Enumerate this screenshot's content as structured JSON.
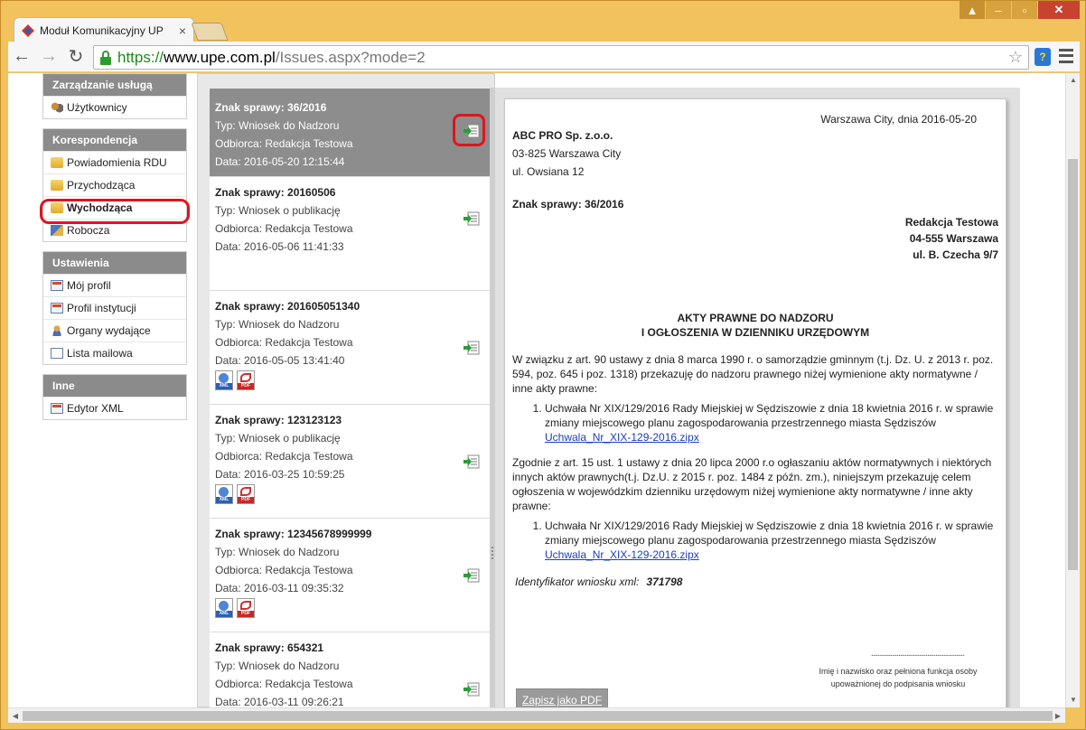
{
  "browser": {
    "tab_title": "Moduł Komunikacyjny UP",
    "tab_close": "×",
    "url_scheme": "https://",
    "url_host": "www.upe.com.pl",
    "url_path": "/Issues.aspx?mode=2",
    "ext_label": "?"
  },
  "sidebar": {
    "groups": [
      {
        "header": "Zarządzanie usługą",
        "items": [
          {
            "label": "Użytkownicy",
            "icon": "users-icon"
          }
        ]
      },
      {
        "header": "Korespondencja",
        "items": [
          {
            "label": "Powiadomienia RDU",
            "icon": "folder-icon"
          },
          {
            "label": "Przychodząca",
            "icon": "folder-icon"
          },
          {
            "label": "Wychodząca",
            "icon": "folder-icon",
            "active": true
          },
          {
            "label": "Robocza",
            "icon": "draft-icon"
          }
        ]
      },
      {
        "header": "Ustawienia",
        "items": [
          {
            "label": "Mój profil",
            "icon": "id-card-icon"
          },
          {
            "label": "Profil instytucji",
            "icon": "id-card-icon"
          },
          {
            "label": "Organy wydające",
            "icon": "person-icon"
          },
          {
            "label": "Lista mailowa",
            "icon": "mail-icon"
          }
        ]
      },
      {
        "header": "Inne",
        "items": [
          {
            "label": "Edytor XML",
            "icon": "id-card-icon"
          }
        ]
      }
    ]
  },
  "issues": [
    {
      "title": "Znak sprawy: 36/2016",
      "type": "Typ: Wniosek do Nadzoru",
      "recipient": "Odbiorca: Redakcja Testowa",
      "date": "Data: 2016-05-20 12:15:44",
      "files": false,
      "selected": true
    },
    {
      "title": "Znak sprawy: 20160506",
      "type": "Typ: Wniosek o publikację",
      "recipient": "Odbiorca: Redakcja Testowa",
      "date": "Data: 2016-05-06 11:41:33",
      "files": false
    },
    {
      "title": "Znak sprawy: 201605051340",
      "type": "Typ: Wniosek do Nadzoru",
      "recipient": "Odbiorca: Redakcja Testowa",
      "date": "Data: 2016-05-05 13:41:40",
      "files": true
    },
    {
      "title": "Znak sprawy: 123123123",
      "type": "Typ: Wniosek o publikację",
      "recipient": "Odbiorca: Redakcja Testowa",
      "date": "Data: 2016-03-25 10:59:25",
      "files": true
    },
    {
      "title": "Znak sprawy: 12345678999999",
      "type": "Typ: Wniosek do Nadzoru",
      "recipient": "Odbiorca: Redakcja Testowa",
      "date": "Data: 2016-03-11 09:35:32",
      "files": true
    },
    {
      "title": "Znak sprawy: 654321",
      "type": "Typ: Wniosek do Nadzoru",
      "recipient": "Odbiorca: Redakcja Testowa",
      "date": "Data: 2016-03-11 09:26:21",
      "files": true
    }
  ],
  "file_labels": {
    "xml": "XML",
    "pdf": "PDF"
  },
  "document": {
    "place_date": "Warszawa City, dnia 2016-05-20",
    "sender_name": "ABC PRO Sp. z.o.o.",
    "sender_city": "03-825 Warszawa City",
    "sender_street": "ul. Owsiana 12",
    "case_number": "Znak sprawy: 36/2016",
    "recipient_name": "Redakcja Testowa",
    "recipient_city": "04-555 Warszawa",
    "recipient_street": "ul. B. Czecha 9/7",
    "heading_line1": "AKTY PRAWNE DO NADZORU",
    "heading_line2": "I OGŁOSZENIA W DZIENNIKU URZĘDOWYM",
    "para1": "W związku z art. 90 ustawy z dnia 8 marca 1990 r. o samorządzie gminnym (t.j. Dz. U. z 2013 r. poz. 594, poz. 645 i poz. 1318) przekazuję do nadzoru prawnego niżej wymienione akty normatywne / inne akty prawne:",
    "item1_text": "Uchwała Nr XIX/129/2016 Rady Miejskiej w Sędziszowie z dnia 18 kwietnia 2016 r. w sprawie zmiany miejscowego planu zagospodarowania przestrzennego miasta Sędziszów",
    "item1_link": "Uchwala_Nr_XIX-129-2016.zipx",
    "para2": "Zgodnie z art. 15 ust. 1 ustawy z dnia 20 lipca 2000 r.o ogłaszaniu aktów normatywnych i niektórych innych aktów prawnych(t.j. Dz.U. z 2015 r. poz. 1484 z późn. zm.), niniejszym przekazuję celem ogłoszenia w wojewódzkim dzienniku urzędowym niżej wymienione akty normatywne / inne akty prawne:",
    "item2_text": "Uchwała Nr XIX/129/2016 Rady Miejskiej w Sędziszowie z dnia 18 kwietnia 2016 r. w sprawie zmiany miejscowego planu zagospodarowania przestrzennego miasta Sędziszów",
    "item2_link": "Uchwala_Nr_XIX-129-2016.zipx",
    "ident_label": "Identyfikator wniosku xml:",
    "ident_value": "371798",
    "signature_dots": "..........................................................",
    "signature_line1": "Imię i nazwisko oraz pełniona funkcja osoby",
    "signature_line2": "upoważnionej do podpisania wniosku",
    "save_pdf": "Zapisz jako PDF"
  }
}
